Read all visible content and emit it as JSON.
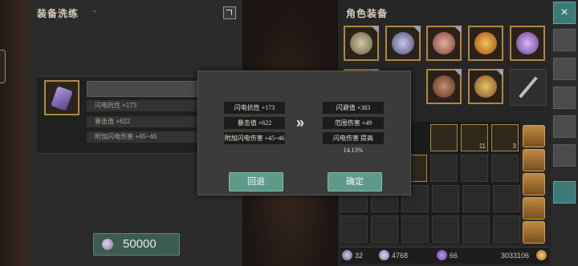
{
  "left_panel": {
    "title": "装备洗练",
    "title_marker": "-",
    "current_stats": [
      "闪电抗性 +173",
      "暴击值 +622",
      "附加闪电伤害 +45~46"
    ],
    "cost": "50000"
  },
  "right_panel": {
    "title": "角色装备",
    "title_marker": "-",
    "bag_counts": {
      "cell_5": "11",
      "cell_6": "3"
    },
    "currency": {
      "a": "32",
      "b": "4768",
      "c": "66",
      "d": "3033106"
    }
  },
  "modal": {
    "old_stats": [
      "闪电抗性 +173",
      "暴击值 +622",
      "附加闪电伤害 +45~46"
    ],
    "arrow": "»",
    "new_stats": [
      "闪避值 +383",
      "范围伤害 +49",
      "闪电伤害 提高 14.13%"
    ],
    "revert_label": "回退",
    "confirm_label": "确定"
  },
  "toolbar": {
    "close_label": "×"
  },
  "colors": {
    "accent_teal": "#5e9a8a",
    "item_gold_border": "#b08840"
  }
}
